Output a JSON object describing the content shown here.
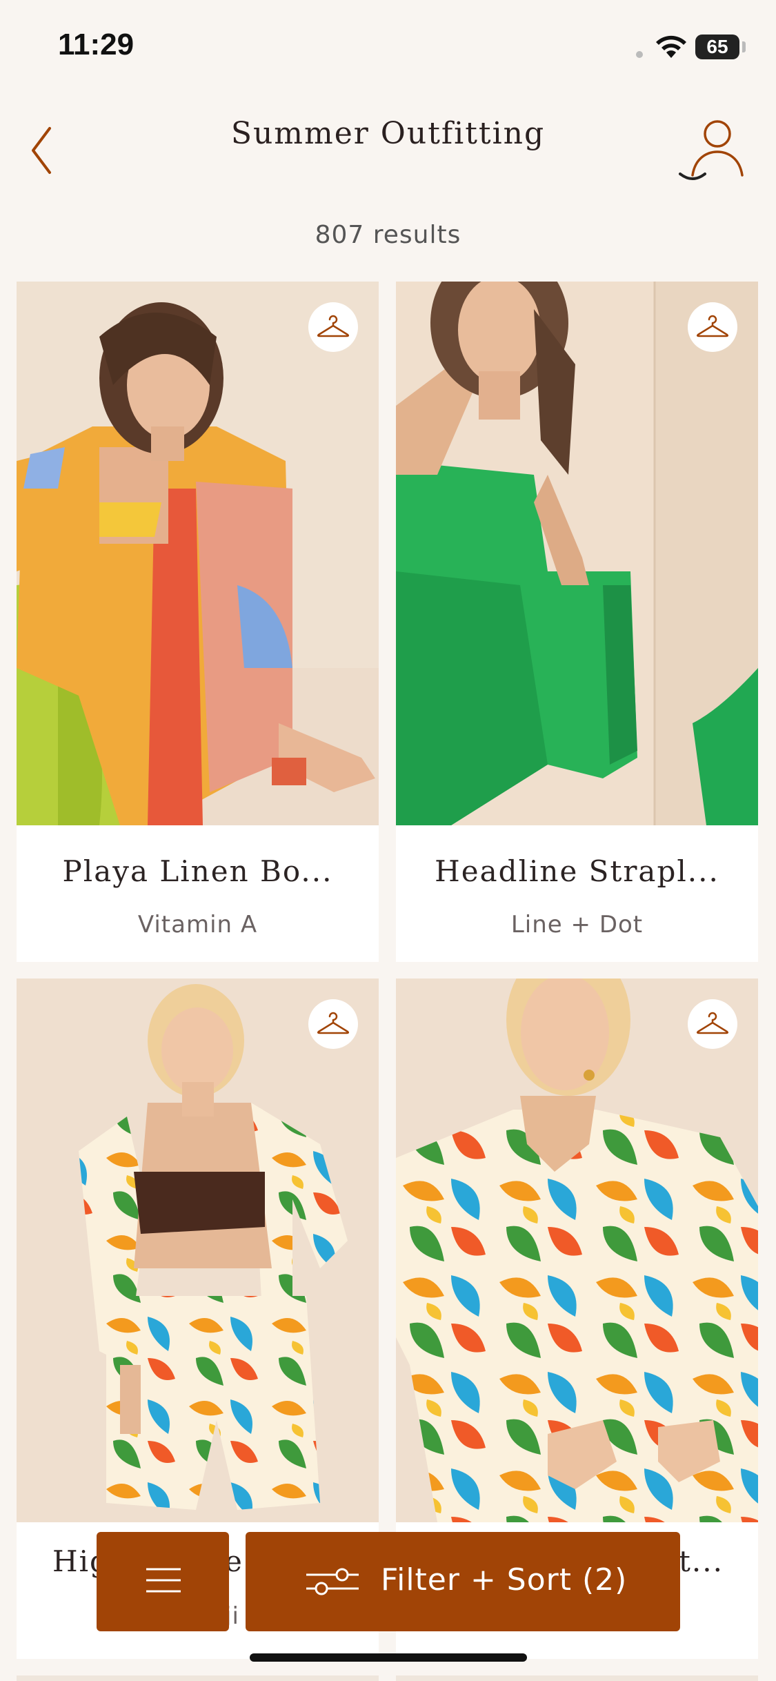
{
  "status_bar": {
    "time": "11:29",
    "battery": "65"
  },
  "header": {
    "title": "Summer Outfitting"
  },
  "results": {
    "count_text": "807 results"
  },
  "products": [
    {
      "name": "Playa Linen Bo...",
      "brand": "Vitamin A"
    },
    {
      "name": "Headline Strapl...",
      "brand": "Line + Dot"
    },
    {
      "name": "Hig",
      "brand": ""
    },
    {
      "name": "",
      "brand": ""
    }
  ],
  "product_3_tail": {
    "name_suffix": "e",
    "brand_prefix": "ji"
  },
  "product_4_tail": {
    "name_suffix": "t..."
  },
  "bottom_bar": {
    "filter_label": "Filter + Sort (2)"
  },
  "icons": {
    "back": "chevron-left-icon",
    "profile": "user-icon",
    "wishlist": "hanger-icon",
    "menu": "hamburger-icon",
    "filter": "sliders-icon"
  },
  "colors": {
    "accent": "#a14406",
    "background": "#f9f5f1",
    "card": "#ffffff"
  }
}
